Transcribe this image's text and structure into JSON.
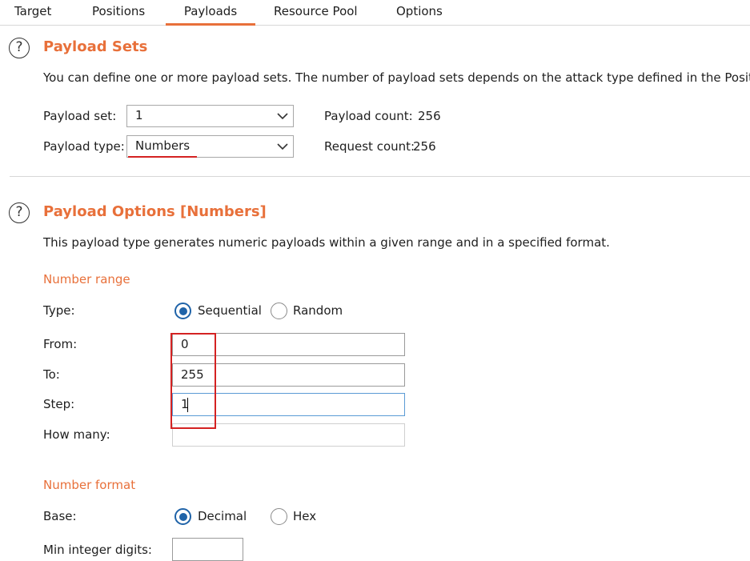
{
  "tabs": [
    {
      "label": "Target"
    },
    {
      "label": "Positions"
    },
    {
      "label": "Payloads",
      "active": true
    },
    {
      "label": "Resource Pool"
    },
    {
      "label": "Options"
    }
  ],
  "payload_sets": {
    "help_icon": "help-circle-icon",
    "title": "Payload Sets",
    "description": "You can define one or more payload sets. The number of payload sets depends on the attack type defined in the Positions",
    "set_label": "Payload set:",
    "set_value": "1",
    "type_label": "Payload type:",
    "type_value": "Numbers",
    "payload_count_label": "Payload count:",
    "payload_count": "256",
    "request_count_label": "Request count:",
    "request_count": "256"
  },
  "payload_options": {
    "help_icon": "help-circle-icon",
    "title": "Payload Options [Numbers]",
    "description": "This payload type generates numeric payloads within a given range and in a specified format.",
    "number_range": {
      "heading": "Number range",
      "type_label": "Type:",
      "sequential_label": "Sequential",
      "random_label": "Random",
      "selected": "Sequential",
      "from_label": "From:",
      "from_value": "0",
      "to_label": "To:",
      "to_value": "255",
      "step_label": "Step:",
      "step_value": "1",
      "how_many_label": "How many:",
      "how_many_value": ""
    },
    "number_format": {
      "heading": "Number format",
      "base_label": "Base:",
      "decimal_label": "Decimal",
      "hex_label": "Hex",
      "selected": "Decimal",
      "min_integer_digits_label": "Min integer digits:",
      "min_integer_digits_value": ""
    }
  },
  "colors": {
    "accent": "#e8703a",
    "radio_selected": "#1f63a8",
    "highlight_annotation": "#d42222"
  }
}
